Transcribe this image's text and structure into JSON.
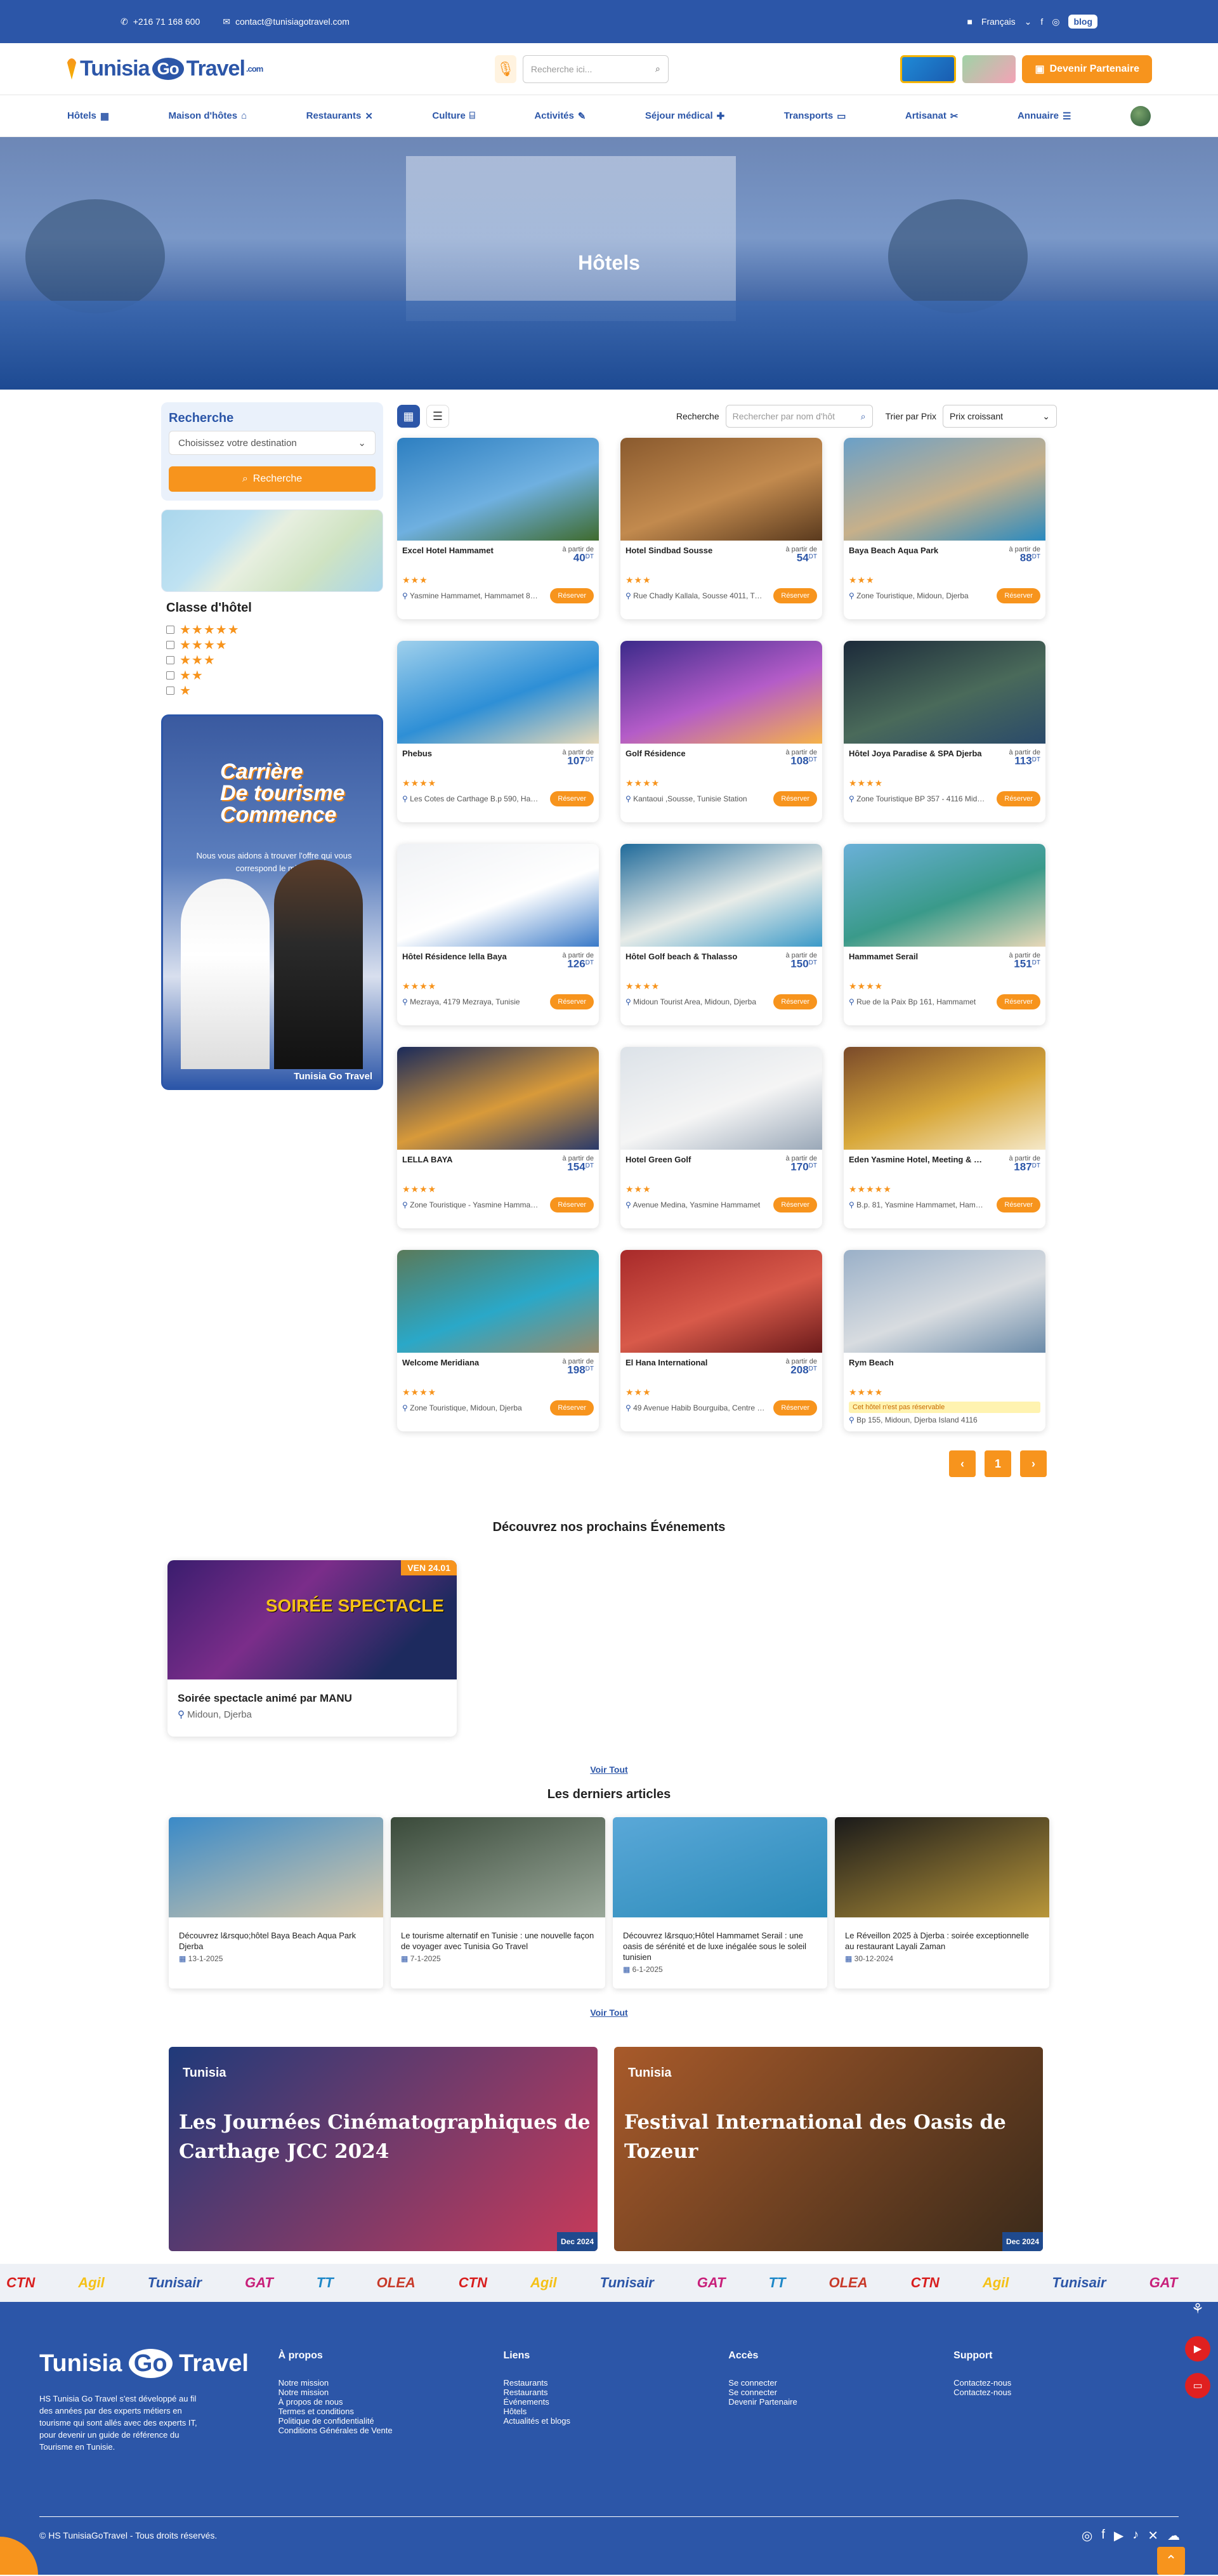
{
  "topbar": {
    "phone": "+216 71 168 600",
    "email": "contact@tunisiagotravel.com",
    "language": "Français",
    "blog": "blog"
  },
  "header": {
    "logo_left": "Tunisia",
    "logo_go": "Go",
    "logo_right": "Travel",
    "logo_com": ".com",
    "search_placeholder": "Recherche ici...",
    "partner_button": "Devenir Partenaire"
  },
  "nav": [
    "Hôtels",
    "Maison d'hôtes",
    "Restaurants",
    "Culture",
    "Activités",
    "Séjour médical",
    "Transports",
    "Artisanat",
    "Annuaire"
  ],
  "hero": {
    "title": "Hôtels"
  },
  "sidebar": {
    "search_title": "Recherche",
    "destination_placeholder": "Choisissez votre destination",
    "search_button": "Recherche",
    "class_title": "Classe d'hôtel",
    "classes": [
      "★★★★★",
      "★★★★",
      "★★★",
      "★★",
      "★"
    ],
    "promo_line1": "Carrière",
    "promo_line2": "De tourisme",
    "promo_line3": "Commence",
    "promo_text": "Nous vous aidons à trouver l'offre qui vous correspond le mieux.",
    "promo_logo": "Tunisia Go Travel"
  },
  "toolbar": {
    "search_label": "Recherche",
    "search_placeholder": "Rechercher par nom d'hôt",
    "sort_label": "Trier par Prix",
    "sort_value": "Prix croissant"
  },
  "price_prefix": "à partir de",
  "currency": "DT",
  "reserve_label": "Réserver",
  "hotels": [
    {
      "name": "Excel Hotel Hammamet",
      "price": "40",
      "stars": "★★★",
      "address": "Yasmine Hammamet, Hammamet 8050",
      "colors": [
        "#2d7fc1",
        "#6fb0e0",
        "#3f6b2e"
      ]
    },
    {
      "name": "Hotel Sindbad Sousse",
      "price": "54",
      "stars": "★★★",
      "address": "Rue Chadly Kallala, Sousse 4011, Tunisie",
      "colors": [
        "#8a5a2e",
        "#c28a4e",
        "#5a3a1e"
      ]
    },
    {
      "name": "Baya Beach Aqua Park",
      "price": "88",
      "stars": "★★★",
      "address": "Zone Touristique, Midoun, Djerba",
      "colors": [
        "#6aa0c8",
        "#c7b08a",
        "#2a8abf"
      ]
    },
    {
      "name": "Phebus",
      "price": "107",
      "stars": "★★★★",
      "address": "Les Cotes de Carthage B.p 590, Hammamet",
      "colors": [
        "#9fd0ec",
        "#2e8fd6",
        "#e7d9b8"
      ]
    },
    {
      "name": "Golf Résidence",
      "price": "108",
      "stars": "★★★★",
      "address": "Kantaoui ,Sousse, Tunisie Station",
      "colors": [
        "#3b2a8a",
        "#b45cc8",
        "#f5b24a"
      ]
    },
    {
      "name": "Hôtel Joya Paradise & SPA Djerba",
      "price": "113",
      "stars": "★★★★",
      "address": "Zone Touristique BP 357 - 4116 Midoun",
      "colors": [
        "#1c2a3a",
        "#4a6a5a",
        "#2a4a6a"
      ]
    },
    {
      "name": "Hôtel Résidence lella Baya",
      "price": "126",
      "stars": "★★★★",
      "address": "Mezraya, 4179 Mezraya, Tunisie",
      "colors": [
        "#f0f2f5",
        "#ffffff",
        "#3a7ac8"
      ]
    },
    {
      "name": "Hôtel Golf beach & Thalasso",
      "price": "150",
      "stars": "★★★★",
      "address": "Midoun Tourist Area, Midoun, Djerba",
      "colors": [
        "#1f6a9a",
        "#e8ece8",
        "#3b9ac8"
      ]
    },
    {
      "name": "Hammamet Serail",
      "price": "151",
      "stars": "★★★★",
      "address": "Rue de la Paix Bp 161, Hammamet",
      "colors": [
        "#6ab0d8",
        "#3a9a8a",
        "#e8d8b8"
      ]
    },
    {
      "name": "LELLA BAYA",
      "price": "154",
      "stars": "★★★★",
      "address": "Zone Touristique - Yasmine Hammamet",
      "colors": [
        "#1a2a5a",
        "#d89a3a",
        "#2a3a6a"
      ]
    },
    {
      "name": "Hotel Green Golf",
      "price": "170",
      "stars": "★★★",
      "address": "Avenue Medina, Yasmine Hammamet",
      "colors": [
        "#dce2e8",
        "#f5f5f5",
        "#9aa8b8"
      ]
    },
    {
      "name": "Eden Yasmine Hotel, Meeting & Spa",
      "price": "187",
      "stars": "★★★★★",
      "address": "B.p. 81, Yasmine Hammamet, Hammamet",
      "colors": [
        "#7a4a2a",
        "#d8a83a",
        "#f5e8c8"
      ]
    },
    {
      "name": "Welcome Meridiana",
      "price": "198",
      "stars": "★★★★",
      "address": "Zone Touristique, Midoun, Djerba",
      "colors": [
        "#5a7a5a",
        "#2aa8c8",
        "#9a8a6a"
      ]
    },
    {
      "name": "El Hana International",
      "price": "208",
      "stars": "★★★",
      "address": "49 Avenue Habib Bourguiba, Centre Ville",
      "colors": [
        "#a82a2a",
        "#d85a4a",
        "#6a1a1a"
      ]
    },
    {
      "name": "Rym Beach",
      "price": "",
      "stars": "★★★★",
      "address": "Bp 155, Midoun, Djerba Island 4116",
      "not_reservable": "Cet hôtel n'est pas réservable",
      "colors": [
        "#9ab0c8",
        "#d8dce0",
        "#6a8aa8"
      ]
    }
  ],
  "pager": {
    "prev": "‹",
    "page": "1",
    "next": "›"
  },
  "events_title": "Découvrez nos prochains Événements",
  "event": {
    "name": "Soirée spectacle animé par MANU",
    "location": "Midoun, Djerba",
    "image_title": "SOIRÉE SPECTACLE",
    "image_date": "VEN 24.01"
  },
  "voir_tout": "Voir Tout",
  "articles_title": "Les derniers articles",
  "articles": [
    {
      "title": "Découvrez l&rsquo;hôtel Baya Beach Aqua Park Djerba",
      "date": "13-1-2025",
      "colors": [
        "#3a8ac8",
        "#d8c8a8"
      ]
    },
    {
      "title": "Le tourisme alternatif en Tunisie : une nouvelle façon de voyager avec Tunisia Go Travel",
      "date": "7-1-2025",
      "colors": [
        "#3a4a3a",
        "#9aa89a"
      ]
    },
    {
      "title": "Découvrez l&rsquo;Hôtel Hammamet Serail : une oasis de sérénité et de luxe inégalée sous le soleil tunisien",
      "date": "6-1-2025",
      "colors": [
        "#5aa8d8",
        "#2a8ab8"
      ]
    },
    {
      "title": "Le Réveillon 2025 à Djerba : soirée exceptionnelle au restaurant Layali Zaman",
      "date": "30-12-2024",
      "colors": [
        "#1a1a1a",
        "#b8963a"
      ]
    }
  ],
  "banners": [
    {
      "title": "Les Journées Cinématographiques de Carthage JCC 2024",
      "corner": "Dec 2024",
      "colors": [
        "#1f3a7a",
        "#c83a5a"
      ]
    },
    {
      "title": "Festival International des Oasis de Tozeur",
      "corner": "Dec 2024",
      "colors": [
        "#a85a2a",
        "#3a2a1a"
      ]
    }
  ],
  "partners": [
    {
      "name": "CTN",
      "color": "#d81e1e"
    },
    {
      "name": "Agil",
      "color": "#f5c118"
    },
    {
      "name": "Tunisair",
      "color": "#2c56a8"
    },
    {
      "name": "GAT",
      "color": "#c8207a"
    },
    {
      "name": "TT",
      "color": "#1e88c8"
    },
    {
      "name": "OLEA",
      "color": "#c83a2a"
    },
    {
      "name": "CTN",
      "color": "#d81e1e"
    },
    {
      "name": "Agil",
      "color": "#f5c118"
    },
    {
      "name": "Tunisair",
      "color": "#2c56a8"
    },
    {
      "name": "GAT",
      "color": "#c8207a"
    },
    {
      "name": "TT",
      "color": "#1e88c8"
    },
    {
      "name": "OLEA",
      "color": "#c83a2a"
    },
    {
      "name": "CTN",
      "color": "#d81e1e"
    },
    {
      "name": "Agil",
      "color": "#f5c118"
    },
    {
      "name": "Tunisair",
      "color": "#2c56a8"
    },
    {
      "name": "GAT",
      "color": "#c8207a"
    },
    {
      "name": "TT",
      "color": "#1e88c8"
    }
  ],
  "footer": {
    "about": "HS Tunisia Go Travel s'est développé au fil des années par des experts métiers en tourisme qui sont allés avec des experts IT, pour devenir un guide de référence du Tourisme en Tunisie.",
    "cols": [
      {
        "title": "À propos",
        "links": [
          "Notre mission",
          "Notre mission",
          "À propos de nous",
          "Termes et conditions",
          "Politique de confidentialité",
          "Conditions Générales de Vente"
        ]
      },
      {
        "title": "Liens",
        "links": [
          "Restaurants",
          "Restaurants",
          "Événements",
          "Hôtels",
          "Actualités et blogs"
        ]
      },
      {
        "title": "Accès",
        "links": [
          "Se connecter",
          "Se connecter",
          "Devenir Partenaire"
        ]
      },
      {
        "title": "Support",
        "links": [
          "Contactez-nous",
          "Contactez-nous"
        ]
      }
    ],
    "copyright": "© HS TunisiaGoTravel - Tous droits réservés."
  }
}
